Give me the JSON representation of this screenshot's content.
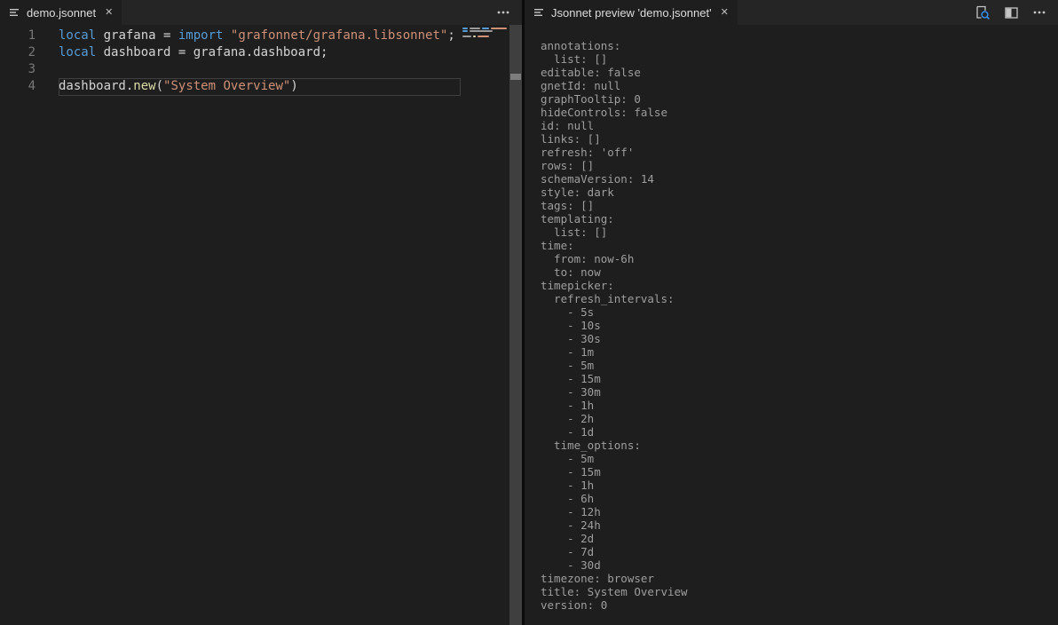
{
  "colors": {
    "editor_background": "#1e1e1e",
    "tabbar_background": "#252526",
    "keyword": "#569cd6",
    "string": "#ce9178",
    "function": "#dcdcaa",
    "foreground": "#d4d4d4",
    "line_number": "#787878",
    "preview_text": "#9e9e9e",
    "accent_blue": "#3794ff",
    "scrollbar_track": "#3f3f3f",
    "scrollbar_handle": "#7d7d7d"
  },
  "icons": {
    "close_glyph": "✕"
  },
  "left_pane": {
    "tab": {
      "label": "demo.jsonnet"
    },
    "editor": {
      "lines": [
        {
          "num": "1",
          "tokens": [
            [
              "kw",
              "local"
            ],
            [
              "fg",
              " grafana = "
            ],
            [
              "kw",
              "import"
            ],
            [
              "fg",
              " "
            ],
            [
              "str",
              "\"grafonnet/grafana.libsonnet\""
            ],
            [
              "fg",
              ";"
            ]
          ]
        },
        {
          "num": "2",
          "tokens": [
            [
              "kw",
              "local"
            ],
            [
              "fg",
              " dashboard = grafana.dashboard;"
            ]
          ]
        },
        {
          "num": "3",
          "tokens": []
        },
        {
          "num": "4",
          "current": true,
          "tokens": [
            [
              "fg",
              "dashboard."
            ],
            [
              "fn",
              "new"
            ],
            [
              "fg",
              "("
            ],
            [
              "str",
              "\"System Overview\""
            ],
            [
              "fg",
              ")"
            ]
          ]
        }
      ],
      "minimap_rows": [
        [
          [
            "#569cd6",
            6
          ],
          [
            "#9a9a9a",
            12
          ],
          [
            "#569cd6",
            8
          ],
          [
            "#ce9178",
            18
          ]
        ],
        [
          [
            "#569cd6",
            6
          ],
          [
            "#9a9a9a",
            26
          ]
        ],
        [],
        [
          [
            "#9a9a9a",
            10
          ],
          [
            "#dcdcaa",
            3
          ],
          [
            "#ce9178",
            13
          ]
        ]
      ]
    }
  },
  "right_pane": {
    "tab": {
      "label": "Jsonnet preview 'demo.jsonnet'"
    },
    "preview_lines": [
      "annotations:",
      "  list: []",
      "editable: false",
      "gnetId: null",
      "graphTooltip: 0",
      "hideControls: false",
      "id: null",
      "links: []",
      "refresh: 'off'",
      "rows: []",
      "schemaVersion: 14",
      "style: dark",
      "tags: []",
      "templating:",
      "  list: []",
      "time:",
      "  from: now-6h",
      "  to: now",
      "timepicker:",
      "  refresh_intervals:",
      "    - 5s",
      "    - 10s",
      "    - 30s",
      "    - 1m",
      "    - 5m",
      "    - 15m",
      "    - 30m",
      "    - 1h",
      "    - 2h",
      "    - 1d",
      "  time_options:",
      "    - 5m",
      "    - 15m",
      "    - 1h",
      "    - 6h",
      "    - 12h",
      "    - 24h",
      "    - 2d",
      "    - 7d",
      "    - 30d",
      "timezone: browser",
      "title: System Overview",
      "version: 0"
    ]
  }
}
